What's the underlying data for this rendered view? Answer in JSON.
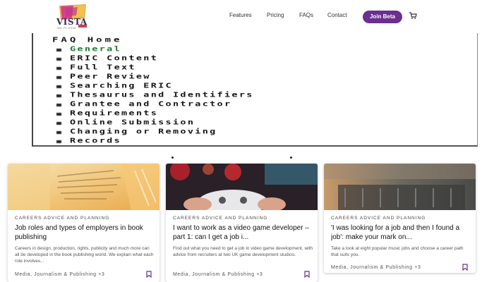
{
  "header": {
    "logo_text": "VISTA",
    "logo_sub": "WE PLUGIN",
    "nav": [
      "Features",
      "Pricing",
      "FAQs",
      "Contact"
    ],
    "join_label": "Join Beta",
    "cart_icon": "cart-icon",
    "brand_color": "#6a2f8f"
  },
  "faq": {
    "lines": [
      "FAQ Home",
      "General",
      "ERIC Content",
      "Full Text",
      "Peer Review",
      "Searching ERIC",
      "Thesaurus and Identifiers",
      "Grantee and Contractor",
      "Requirements",
      "Online Submission",
      "Changing or Removing",
      "Records"
    ]
  },
  "cards": [
    {
      "category": "CAREERS ADVICE AND PLANNING",
      "title": "Job roles and types of employers in book publishing",
      "description": "Careers in design, production, rights, publicity and much more can all be developed in the book publishing world. We explain what each role involves...",
      "tags": "Media, Journalism & Publishing +3",
      "bookmark_icon": "bookmark-icon"
    },
    {
      "category": "CAREERS ADVICE AND PLANNING",
      "title": "I want to work as a video game developer – part 1: can I get a job i...",
      "description": "Find out what you need to get a job in video game development, with advice from recruiters at two UK game development studios.",
      "tags": "Media, Journalism & Publishing +3",
      "bookmark_icon": "bookmark-icon"
    },
    {
      "category": "CAREERS ADVICE AND PLANNING",
      "title": "'I was looking for a job and then I found a job': make your mark on...",
      "description": "Take a look at eight popular music jobs and choose a career path that suits you.",
      "tags": "Media, Journalism & Publishing +3",
      "bookmark_icon": "bookmark-icon"
    }
  ]
}
